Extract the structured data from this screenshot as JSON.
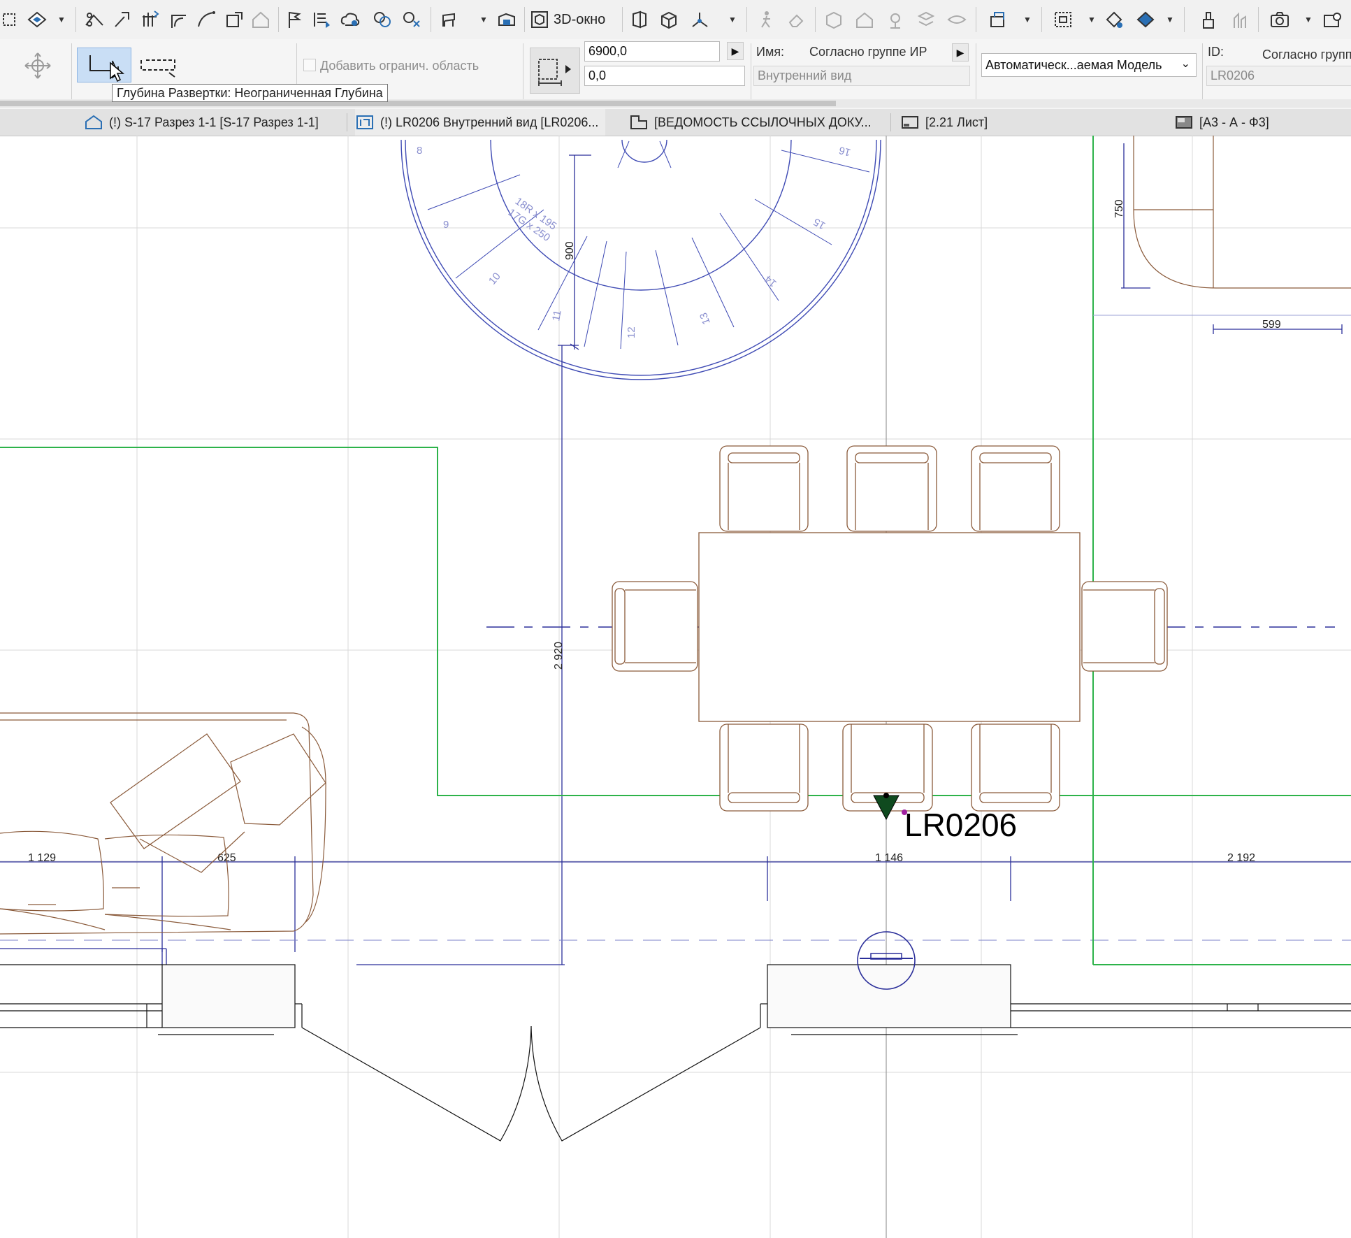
{
  "toolbar": {
    "view3d_label": "3D-окно"
  },
  "info_box": {
    "add_region_label": "Добавить огранич. область",
    "add_region_checked": false,
    "depth_value": "6900,0",
    "offset_value": "0,0",
    "name_label": "Имя:",
    "name_value": "Согласно группе ИР",
    "ref_type": "Внутренний вид",
    "model_select": "Автоматическ...аемая Модель",
    "id_label": "ID:",
    "id_value": "Согласно групп",
    "ref_id": "LR0206"
  },
  "tooltip": "Глубина Развертки: Неограниченная Глубина",
  "tabs": [
    {
      "label": "(!) S-17 Разрез 1-1 [S-17 Разрез 1-1]",
      "icon": "section-icon"
    },
    {
      "label": "(!) LR0206 Внутренний вид [LR0206...",
      "icon": "interior-elevation-icon"
    },
    {
      "label": "[ВЕДОМОСТЬ ССЫЛОЧНЫХ ДОКУ...",
      "icon": "document-list-icon"
    },
    {
      "label": "[2.21 Лист]",
      "icon": "layout-sheet-icon"
    },
    {
      "label": "[А3 - А - Ф3]",
      "icon": "master-layout-icon"
    }
  ],
  "drawing": {
    "marker_label": "LR0206",
    "stair_labels": [
      "8",
      "9",
      "10",
      "11",
      "12",
      "13",
      "14",
      "15",
      "16"
    ],
    "stair_formula": [
      "18R x 195",
      "17G x 250"
    ],
    "dimensions": {
      "stair_rise": "900",
      "room_height": "2 920",
      "cabinet_depth": "750",
      "cabinet_width": "599",
      "dim_1129": "1 129",
      "dim_625": "625",
      "dim_1146": "1 146",
      "dim_2192": "2 192"
    }
  },
  "colors": {
    "grid": "#d8d8d8",
    "furniture": "#8a5a3a",
    "dimension": "#2b2f9a",
    "zone": "#2db34a",
    "active_button": "#c9def5"
  }
}
